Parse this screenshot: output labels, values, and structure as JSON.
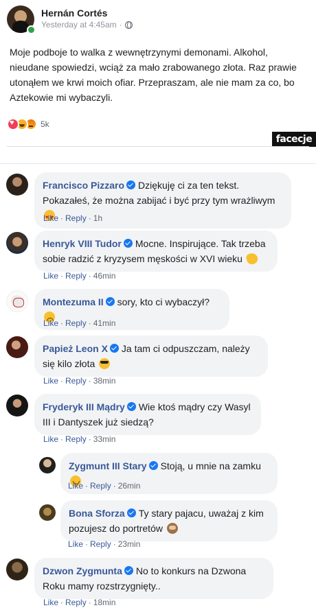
{
  "post": {
    "author": "Hernán Cortés",
    "timestamp": "Yesterday at 4:45am",
    "separator": "·",
    "text": "Moje podboje to walka z wewnętrzynymi demonami. Alkohol, nieudane spowiedzi, wciąż za mało zrabowanego złota. Raz prawie utonąłem we krwi moich ofiar. Przepraszam, ale nie mam za co, bo Aztekowie mi wybaczyli.",
    "reactions": {
      "types": [
        "love",
        "haha",
        "angry"
      ],
      "count": "5k"
    }
  },
  "watermark": "facecje",
  "actions": {
    "like": "Like",
    "reply": "Reply",
    "dot": "·"
  },
  "comments": [
    {
      "name": "Francisco Pizzaro",
      "text": "Dziękuję ci za ten tekst. Pokazałeś, że można zabijać i być przy tym wrażliwym",
      "emoji": "heart-eyes",
      "time": "1h"
    },
    {
      "name": "Henryk VIII Tudor",
      "text": "Mocne. Inspirujące. Tak trzeba sobie radzić z kryzysem męskości w XVI wieku",
      "emoji": "clap",
      "time": "46min"
    },
    {
      "name": "Montezuma II",
      "text": "sory, kto ci wybaczył?",
      "emoji": "sad",
      "time": "41min"
    },
    {
      "name": "Papież Leon X",
      "text": "Ja tam ci odpuszczam, należy się kilo złota",
      "emoji": "sunglasses",
      "time": "38min"
    },
    {
      "name": "Fryderyk III Mądry",
      "text": "Wie ktoś mądry czy Wasyl III i Dantyszek już siedzą?",
      "emoji": "",
      "time": "33min",
      "replies": [
        {
          "name": "Zygmunt III Stary",
          "text": "Stoją, u mnie na zamku",
          "emoji": "smile",
          "time": "26min"
        },
        {
          "name": "Bona Sforza",
          "text": "Ty stary pajacu, uważaj z kim pozujesz do portretów",
          "emoji": "see-no-evil-monkey",
          "time": "23min"
        }
      ]
    },
    {
      "name": "Dzwon Zygmunta",
      "text": "No to konkurs na Dzwona Roku mamy rozstrzygnięty..",
      "emoji": "",
      "time": "18min"
    }
  ]
}
